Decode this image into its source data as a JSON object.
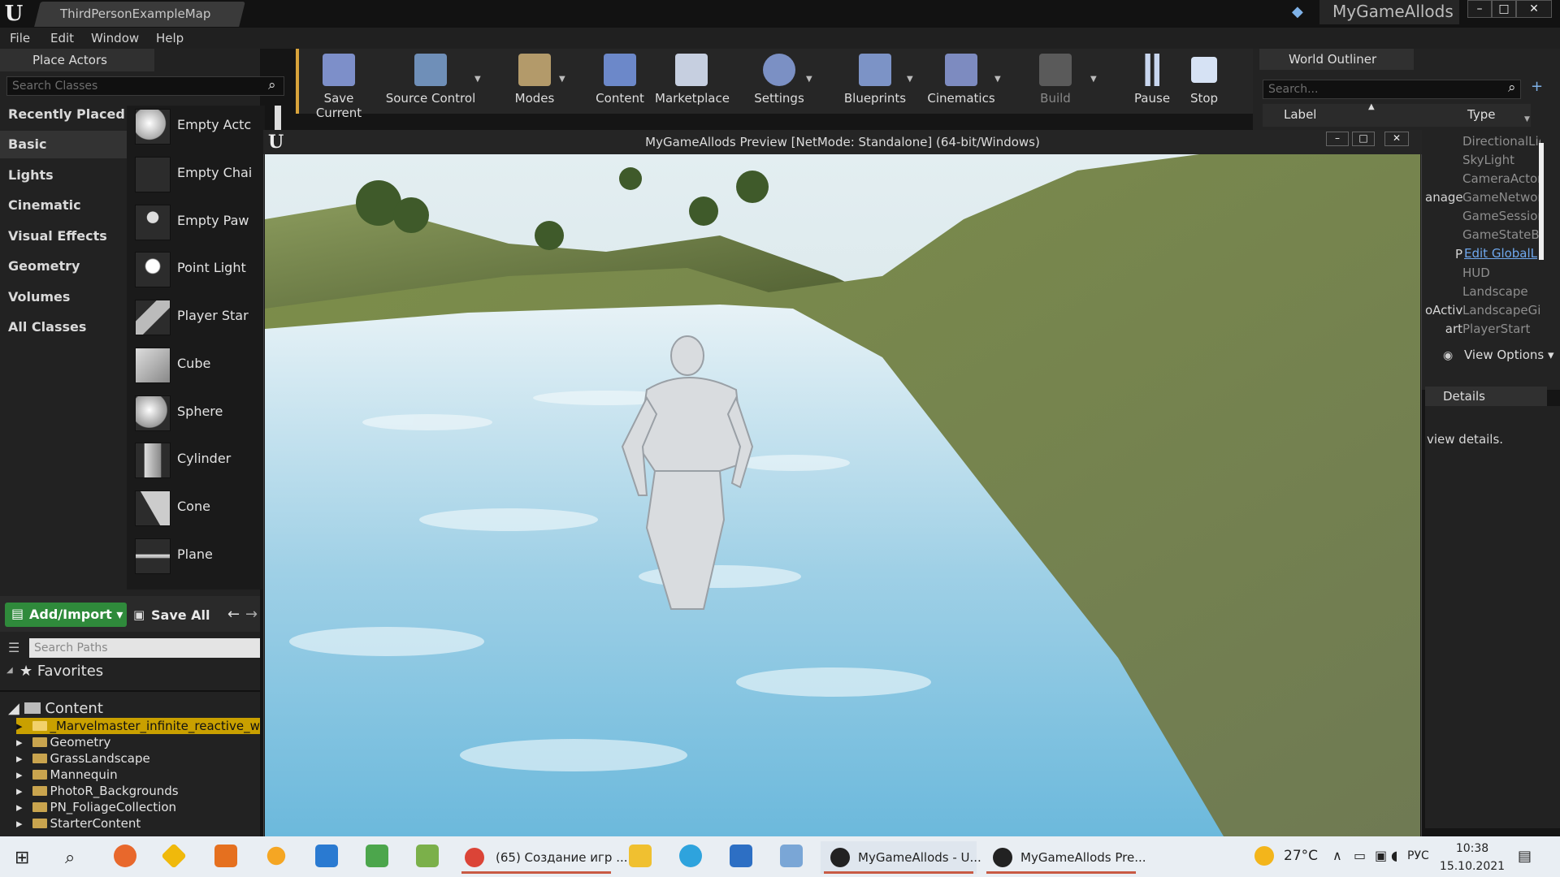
{
  "window": {
    "map_tab": "ThirdPersonExampleMap",
    "project_name": "MyGameAllods",
    "min": "–",
    "max": "□",
    "close": "✕"
  },
  "menu": [
    "File",
    "Edit",
    "Window",
    "Help"
  ],
  "place_actors": {
    "title": "Place Actors",
    "search_placeholder": "Search Classes",
    "categories": [
      "Recently Placed",
      "Basic",
      "Lights",
      "Cinematic",
      "Visual Effects",
      "Geometry",
      "Volumes",
      "All Classes"
    ],
    "selected_category": "Basic",
    "actors": [
      "Empty Actc",
      "Empty Chai",
      "Empty Paw",
      "Point Light",
      "Player Star",
      "Cube",
      "Sphere",
      "Cylinder",
      "Cone",
      "Plane"
    ]
  },
  "toolbar": {
    "items": [
      "Save Current",
      "Source Control",
      "Modes",
      "Content",
      "Marketplace",
      "Settings",
      "Blueprints",
      "Cinematics",
      "Build",
      "Pause",
      "Stop"
    ]
  },
  "world_outliner": {
    "title": "World Outliner",
    "search_placeholder": "Search...",
    "col_label": "Label",
    "col_type": "Type",
    "rows": [
      {
        "left": "",
        "type": "DirectionalLic"
      },
      {
        "left": "",
        "type": "SkyLight"
      },
      {
        "left": "",
        "type": "CameraActor"
      },
      {
        "left": "anager",
        "type": "GameNetworl"
      },
      {
        "left": "",
        "type": "GameSessior"
      },
      {
        "left": "",
        "type": "GameStateBa"
      },
      {
        "left": "P",
        "type": "Edit GlobalL"
      },
      {
        "left": "",
        "type": "HUD"
      },
      {
        "left": "",
        "type": "Landscape"
      },
      {
        "left": "oActive",
        "type": "LandscapeGi"
      },
      {
        "left": "art",
        "type": "PlayerStart"
      }
    ],
    "view_options": "View Options"
  },
  "details": {
    "title": "Details",
    "hint": "view details."
  },
  "content_browser": {
    "add_import": "Add/Import",
    "save_all": "Save All",
    "search_placeholder": "Search Paths",
    "favorites": "Favorites",
    "root": "Content",
    "folders": [
      "_Marvelmaster_infinite_reactive_w",
      "Geometry",
      "GrassLandscape",
      "Mannequin",
      "PhotoR_Backgrounds",
      "PN_FoliageCollection",
      "StarterContent"
    ]
  },
  "game_window": {
    "title": "MyGameAllods Preview [NetMode: Standalone]  (64-bit/Windows)"
  },
  "taskbar": {
    "tasks": [
      "(65) Создание игр ...",
      "MyGameAllods - U...",
      "MyGameAllods Pre..."
    ],
    "temperature": "27°C",
    "language": "РУС",
    "time": "10:38",
    "date": "15.10.2021"
  }
}
